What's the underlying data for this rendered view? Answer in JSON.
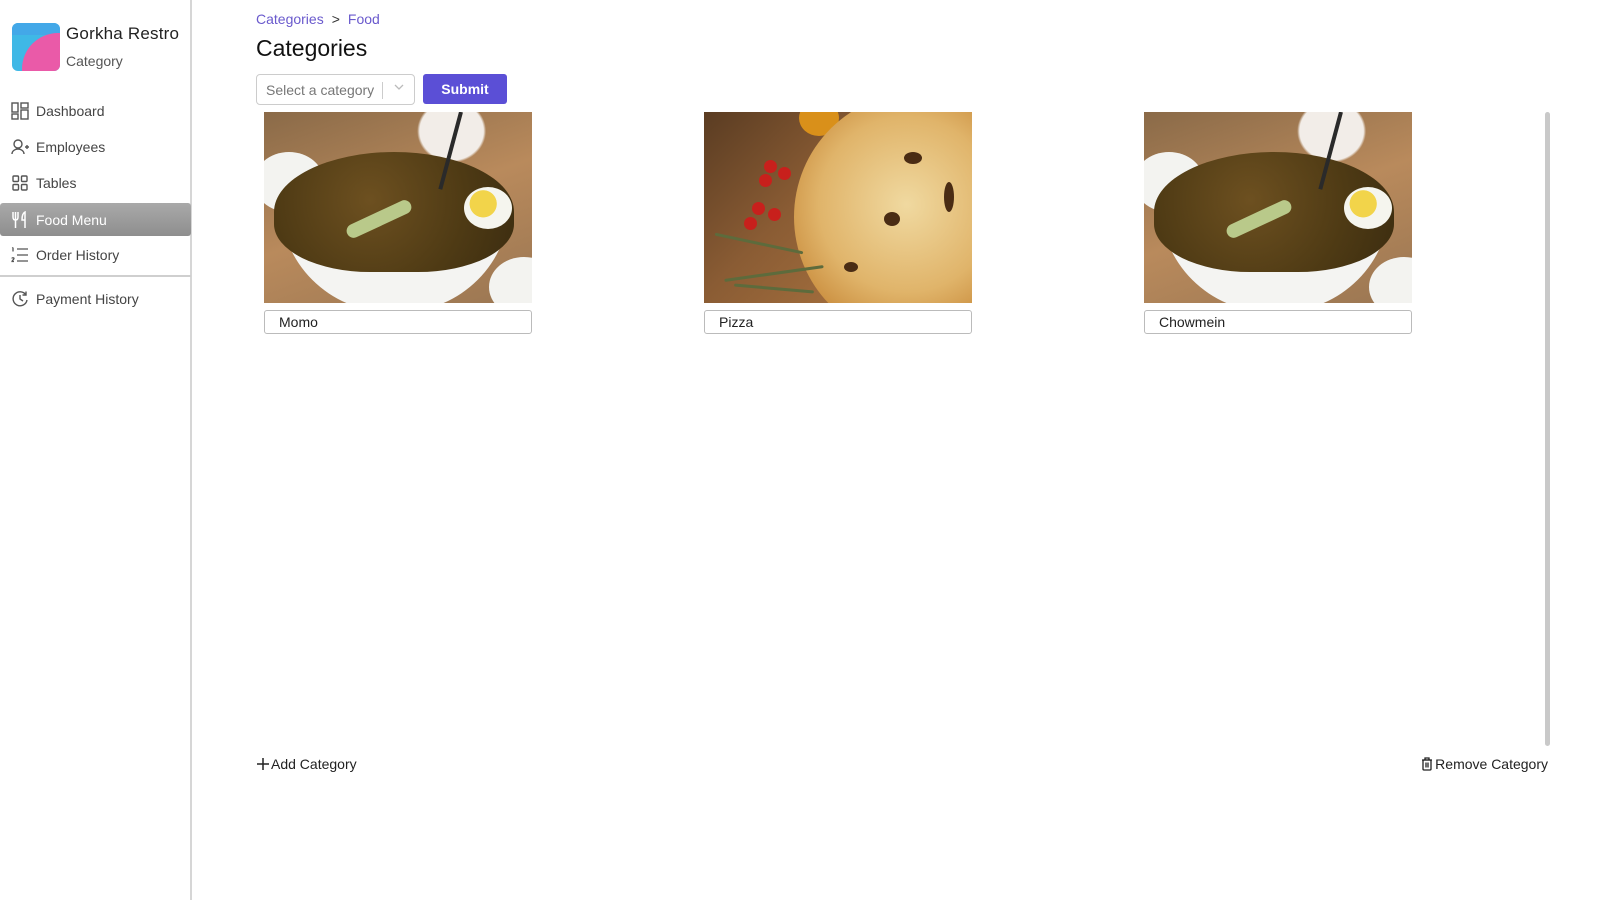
{
  "brand": {
    "name": "Gorkha Restro",
    "subtitle": "Category",
    "logo_colors": [
      "#3fb8e6",
      "#ea5aa8"
    ]
  },
  "sidebar": {
    "items": [
      {
        "label": "Dashboard",
        "icon": "dashboard-icon",
        "active": false
      },
      {
        "label": "Employees",
        "icon": "user-plus-icon",
        "active": false
      },
      {
        "label": "Tables",
        "icon": "grid-icon",
        "active": false
      },
      {
        "label": "Food Menu",
        "icon": "utensils-icon",
        "active": true
      },
      {
        "label": "Order History",
        "icon": "ordered-list-icon",
        "active": false
      },
      {
        "label": "Payment History",
        "icon": "history-icon",
        "active": false
      }
    ]
  },
  "breadcrumb": {
    "items": [
      "Categories",
      "Food"
    ],
    "separator": ">"
  },
  "page": {
    "title": "Categories"
  },
  "toolbar": {
    "select_placeholder": "Select a category",
    "submit_label": "Submit",
    "accent_color": "#5b4fd6"
  },
  "categories": [
    {
      "name": "Momo",
      "image": "noodles-bowl"
    },
    {
      "name": "Pizza",
      "image": "pizza"
    },
    {
      "name": "Chowmein",
      "image": "noodles-bowl"
    }
  ],
  "actions": {
    "add_label": "Add Category",
    "remove_label": "Remove Category"
  }
}
